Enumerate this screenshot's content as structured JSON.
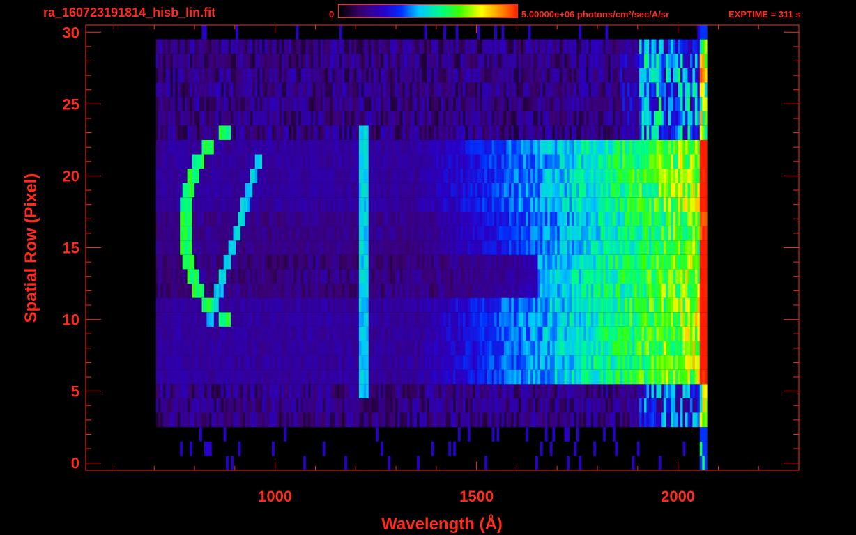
{
  "header": {
    "title": "ra_160723191814_hisb_lin.fit",
    "colorbar_min": "0",
    "colorbar_max": "5.00000e+06 photons/cm²/sec/A/sr",
    "exptime": "EXPTIME = 311 s"
  },
  "colors": {
    "axis": "#ff2a1a",
    "background": "#000000"
  },
  "chart_data": {
    "type": "heatmap",
    "title": "ra_160723191814_hisb_lin.fit",
    "xlabel": "Wavelength (Å)",
    "ylabel": "Spatial Row (Pixel)",
    "xlim": [
      530,
      2300
    ],
    "ylim": [
      -0.5,
      30.5
    ],
    "x_ticks": [
      1000,
      1500,
      2000
    ],
    "y_ticks": [
      0,
      5,
      10,
      15,
      20,
      25,
      30
    ],
    "colorbar_range": [
      0,
      5000000
    ],
    "colorbar_units": "photons/cm²/sec/A/sr",
    "colormap": "rainbow",
    "data_extent_wavelength": [
      700,
      2070
    ],
    "bright_rows": [
      6,
      23
    ],
    "features": [
      {
        "label": "Lyman-alpha",
        "wavelength": 1216
      },
      {
        "label": "curved arc",
        "wavelength_range": [
          780,
          920
        ],
        "rows": [
          10,
          23
        ]
      }
    ]
  }
}
